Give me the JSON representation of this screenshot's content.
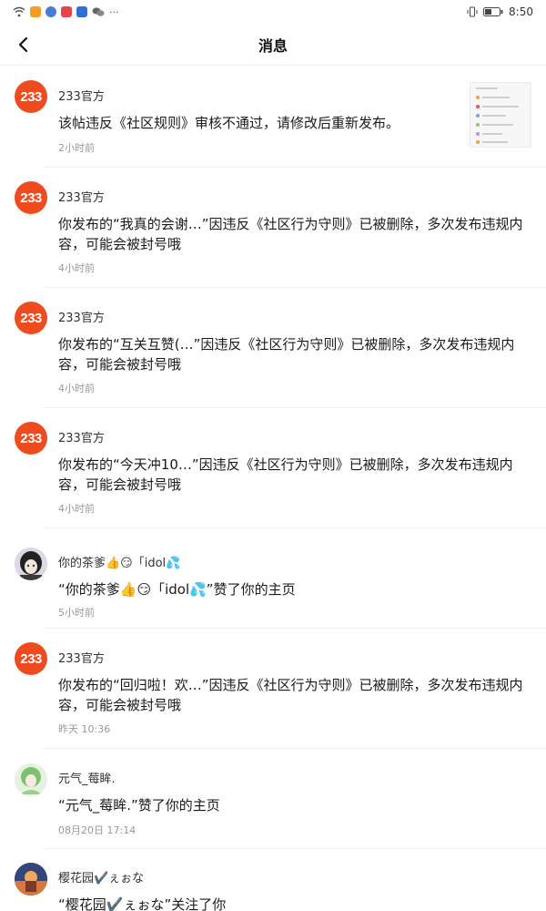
{
  "status_bar": {
    "time": "8:50"
  },
  "header": {
    "title": "消息",
    "back_icon": "chevron-left-icon"
  },
  "messages": [
    {
      "sender": "233官方",
      "avatar": "233",
      "text": "该帖违反《社区规则》审核不通过，请修改后重新发布。",
      "time": "2小时前",
      "has_thumbnail": true
    },
    {
      "sender": "233官方",
      "avatar": "233",
      "text": "你发布的“我真的会谢…”因违反《社区行为守则》已被删除，多次发布违规内容，可能会被封号哦",
      "time": "4小时前"
    },
    {
      "sender": "233官方",
      "avatar": "233",
      "text": "你发布的“互关互赞(…”因违反《社区行为守则》已被删除，多次发布违规内容，可能会被封号哦",
      "time": "4小时前"
    },
    {
      "sender": "233官方",
      "avatar": "233",
      "text": "你发布的“今天冲10…”因违反《社区行为守则》已被删除，多次发布违规内容，可能会被封号哦",
      "time": "4小时前"
    },
    {
      "sender": "你的茶爹👍😏「idol💦",
      "avatar": "user1",
      "text": "“你的茶爹👍😏「idol💦”赞了你的主页",
      "time": "5小时前"
    },
    {
      "sender": "233官方",
      "avatar": "233",
      "text": "你发布的“回归啦！欢…”因违反《社区行为守则》已被删除，多次发布违规内容，可能会被封号哦",
      "time": "昨天 10:36"
    },
    {
      "sender": "元气_莓眸.",
      "avatar": "user2",
      "text": "“元气_莓眸.”赞了你的主页",
      "time": "08月20日 17:14"
    },
    {
      "sender": "樱花园✔️ぇぉな",
      "avatar": "user3",
      "text": "“樱花园✔️ぇぉな”关注了你",
      "time": ""
    }
  ],
  "colors": {
    "brand": "#f04a1f",
    "time_text": "#999999",
    "divider": "#eeeeee"
  }
}
